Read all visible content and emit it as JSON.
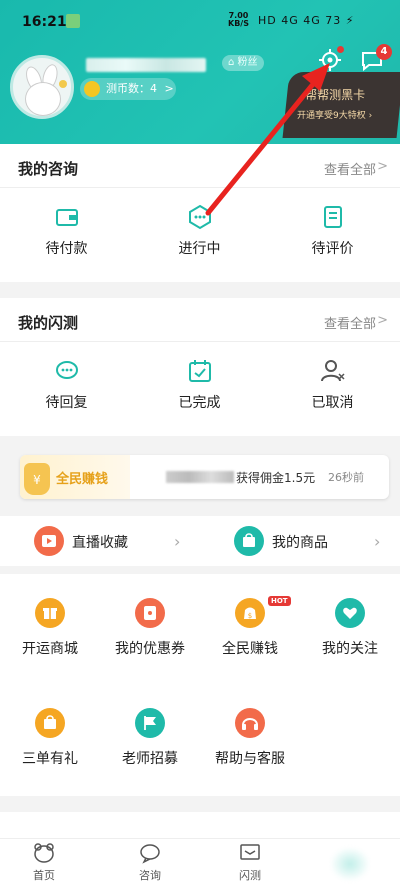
{
  "status": {
    "time": "16:21",
    "speed_value": "7.00",
    "speed_unit": "KB/S",
    "icons_text": "HD 4G 4G 73 ⚡"
  },
  "profile": {
    "fans_label": "粉丝",
    "coins_label": "测币数：4",
    "coins_arrow": ">"
  },
  "header_icons": {
    "message_count": "4"
  },
  "black_card": {
    "title": "帮帮测黑卡",
    "subtitle": "开通享受9大特权 ›"
  },
  "consult": {
    "title": "我的咨询",
    "more": "查看全部",
    "chevron": ">",
    "items": [
      {
        "label": "待付款",
        "icon": "wallet-icon"
      },
      {
        "label": "进行中",
        "icon": "chat-dots-icon"
      },
      {
        "label": "待评价",
        "icon": "document-icon"
      }
    ]
  },
  "flash": {
    "title": "我的闪测",
    "more": "查看全部",
    "chevron": ">",
    "items": [
      {
        "label": "待回复",
        "icon": "chat-bubble-icon"
      },
      {
        "label": "已完成",
        "icon": "calendar-check-icon"
      },
      {
        "label": "已取消",
        "icon": "user-cancel-icon"
      }
    ]
  },
  "earn_banner": {
    "tag": "全民赚钱",
    "message": "获得佣金1.5元",
    "time_ago": "26秒前",
    "arrow": "›"
  },
  "shortcuts": [
    {
      "label": "直播收藏",
      "icon": "play-icon",
      "color": "#f26b4a",
      "chevron": "›"
    },
    {
      "label": "我的商品",
      "icon": "bag-icon",
      "color": "#1fbaa9",
      "chevron": "›"
    }
  ],
  "grid": [
    {
      "label": "开运商城",
      "icon": "gift-icon",
      "color": "#f5a623"
    },
    {
      "label": "我的优惠券",
      "icon": "coupon-icon",
      "color": "#f26b4a"
    },
    {
      "label": "全民赚钱",
      "icon": "money-bag-icon",
      "color": "#f5a623"
    },
    {
      "label": "我的关注",
      "icon": "heart-icon",
      "color": "#1fbaa9"
    },
    {
      "label": "三单有礼",
      "icon": "shopping-bag-icon",
      "color": "#f5a623"
    },
    {
      "label": "老师招募",
      "icon": "flag-icon",
      "color": "#1fbaa9"
    },
    {
      "label": "帮助与客服",
      "icon": "headset-icon",
      "color": "#f26b4a"
    }
  ],
  "hot_badge": "HOT",
  "tabs": [
    {
      "label": "首页",
      "icon": "bear-icon"
    },
    {
      "label": "咨询",
      "icon": "chat-icon"
    },
    {
      "label": "闪测",
      "icon": "inbox-icon"
    }
  ],
  "colors": {
    "brand": "#1fbaa9",
    "accent_orange": "#f5a623",
    "accent_red": "#f26b4a",
    "alert": "#e53935"
  }
}
